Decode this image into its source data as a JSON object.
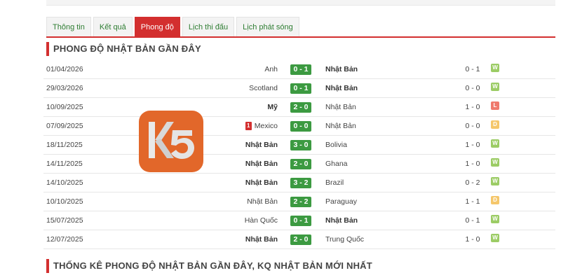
{
  "tabs": [
    {
      "label": "Thông tin",
      "active": false
    },
    {
      "label": "Kết quả",
      "active": false
    },
    {
      "label": "Phong độ",
      "active": true
    },
    {
      "label": "Lịch thi đấu",
      "active": false
    },
    {
      "label": "Lịch phát sóng",
      "active": false
    }
  ],
  "section1_title": "PHONG ĐỘ NHẬT BẢN GẦN ĐÂY",
  "section2_title": "THỐNG KÊ PHONG ĐỘ NHẬT BẢN GẦN ĐÂY, KQ NHẬT BẢN MỚI NHẤT",
  "matches": [
    {
      "date": "01/04/2026",
      "home": "Anh",
      "score": "0 - 1",
      "away": "Nhật Bản",
      "ht": "0 - 1",
      "result": "W",
      "bold": "away",
      "red_card": ""
    },
    {
      "date": "29/03/2026",
      "home": "Scotland",
      "score": "0 - 1",
      "away": "Nhật Bản",
      "ht": "0 - 0",
      "result": "W",
      "bold": "away",
      "red_card": ""
    },
    {
      "date": "10/09/2025",
      "home": "Mỹ",
      "score": "2 - 0",
      "away": "Nhật Bản",
      "ht": "1 - 0",
      "result": "L",
      "bold": "home",
      "red_card": ""
    },
    {
      "date": "07/09/2025",
      "home": "Mexico",
      "score": "0 - 0",
      "away": "Nhật Bản",
      "ht": "0 - 0",
      "result": "D",
      "bold": "",
      "red_card": "1"
    },
    {
      "date": "18/11/2025",
      "home": "Nhật Bản",
      "score": "3 - 0",
      "away": "Bolivia",
      "ht": "1 - 0",
      "result": "W",
      "bold": "home",
      "red_card": ""
    },
    {
      "date": "14/11/2025",
      "home": "Nhật Bản",
      "score": "2 - 0",
      "away": "Ghana",
      "ht": "1 - 0",
      "result": "W",
      "bold": "home",
      "red_card": ""
    },
    {
      "date": "14/10/2025",
      "home": "Nhật Bản",
      "score": "3 - 2",
      "away": "Brazil",
      "ht": "0 - 2",
      "result": "W",
      "bold": "home",
      "red_card": ""
    },
    {
      "date": "10/10/2025",
      "home": "Nhật Bản",
      "score": "2 - 2",
      "away": "Paraguay",
      "ht": "1 - 1",
      "result": "D",
      "bold": "",
      "red_card": ""
    },
    {
      "date": "15/07/2025",
      "home": "Hàn Quốc",
      "score": "0 - 1",
      "away": "Nhật Bản",
      "ht": "0 - 1",
      "result": "W",
      "bold": "away",
      "red_card": ""
    },
    {
      "date": "12/07/2025",
      "home": "Nhật Bản",
      "score": "2 - 0",
      "away": "Trung Quốc",
      "ht": "1 - 0",
      "result": "W",
      "bold": "home",
      "red_card": ""
    }
  ],
  "watermark": {
    "text": "K5",
    "color": "#e2672a"
  },
  "colors": {
    "accent": "#d32f2f",
    "score_bg": "#3c9a41",
    "win": "#9ccc65",
    "loss": "#ef7a6d",
    "draw": "#f5c76b"
  }
}
